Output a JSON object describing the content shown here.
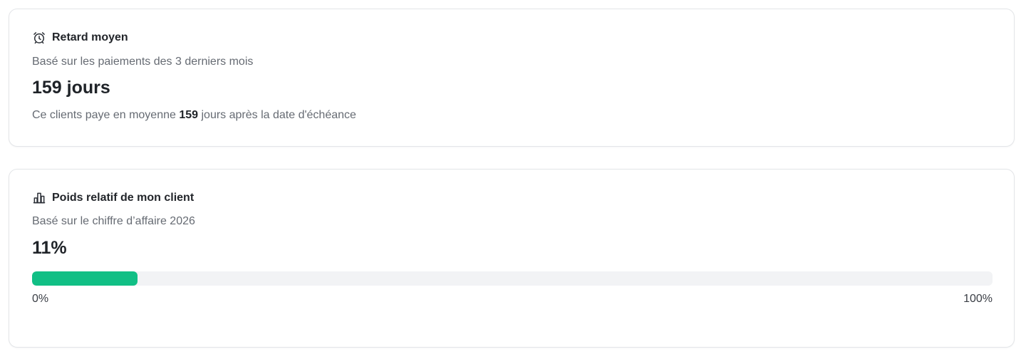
{
  "delay_card": {
    "icon": "alarm-clock-icon",
    "title": "Retard moyen",
    "subtitle": "Basé sur les paiements des 3 derniers mois",
    "value": "159 jours",
    "description_prefix": "Ce clients paye en moyenne ",
    "description_days": "159",
    "description_suffix": " jours après la date d'échéance"
  },
  "weight_card": {
    "icon": "bar-chart-icon",
    "title": "Poids relatif de mon client",
    "subtitle": "Basé sur le chiffre d’affaire 2026",
    "value": "11%",
    "progress_fraction": 0.11,
    "progress_min_label": "0%",
    "progress_max_label": "100%"
  },
  "colors": {
    "progress_fill": "#11bf85",
    "progress_track": "#f2f3f5",
    "card_border": "#e3e5e8"
  }
}
